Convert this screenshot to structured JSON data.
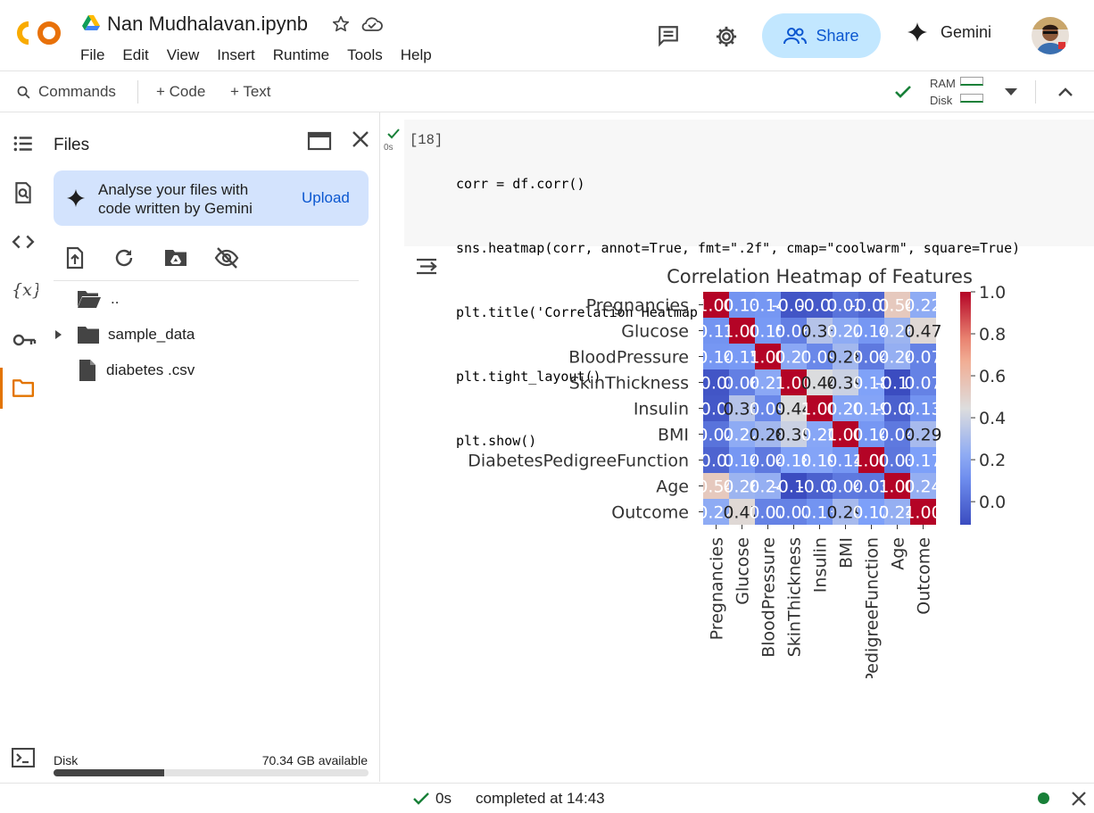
{
  "header": {
    "notebook_title": "Nan Mudhalavan.ipynb",
    "menu": [
      "File",
      "Edit",
      "View",
      "Insert",
      "Runtime",
      "Tools",
      "Help"
    ],
    "share_label": "Share",
    "gemini_label": "Gemini",
    "logo_text": "CO"
  },
  "toolbar": {
    "commands_label": "Commands",
    "code_label": "+ Code",
    "text_label": "+ Text",
    "ram_label": "RAM",
    "disk_label": "Disk"
  },
  "files": {
    "title": "Files",
    "gemini_card_line1": "Analyse your files with",
    "gemini_card_line2": "code written by Gemini",
    "upload_label": "Upload",
    "items": [
      {
        "name": "..",
        "icon": "folder-open-icon"
      },
      {
        "name": "sample_data",
        "icon": "folder-icon"
      },
      {
        "name": "diabetes .csv",
        "icon": "file-icon"
      }
    ],
    "disk_label": "Disk",
    "disk_available": "70.34 GB available",
    "disk_used_fraction": 0.35
  },
  "cell": {
    "exec_count": "[18]",
    "exec_time": "0s",
    "code_lines": [
      "corr = df.corr()",
      "sns.heatmap(corr, annot=True, fmt=\".2f\", cmap=\"coolwarm\", square=True)",
      "plt.title('Correlation Heatmap of Features')",
      "plt.tight_layout()",
      "plt.show()"
    ]
  },
  "chart_data": {
    "type": "heatmap",
    "title": "Correlation Heatmap of Features",
    "labels": [
      "Pregnancies",
      "Glucose",
      "BloodPressure",
      "SkinThickness",
      "Insulin",
      "BMI",
      "DiabetesPedigreeFunction",
      "Age",
      "Outcome"
    ],
    "matrix": [
      [
        1.0,
        0.13,
        0.14,
        -0.08,
        -0.07,
        0.02,
        -0.03,
        0.54,
        0.22
      ],
      [
        0.13,
        1.0,
        0.15,
        0.06,
        0.33,
        0.22,
        0.14,
        0.26,
        0.47
      ],
      [
        0.14,
        0.15,
        1.0,
        0.21,
        0.09,
        0.28,
        0.04,
        0.24,
        0.07
      ],
      [
        -0.08,
        0.06,
        0.21,
        1.0,
        0.44,
        0.39,
        0.18,
        -0.11,
        0.07
      ],
      [
        -0.07,
        0.33,
        0.09,
        0.44,
        1.0,
        0.2,
        0.19,
        -0.04,
        0.13
      ],
      [
        0.02,
        0.22,
        0.28,
        0.39,
        0.2,
        1.0,
        0.14,
        0.04,
        0.29
      ],
      [
        -0.03,
        0.14,
        0.04,
        0.18,
        0.19,
        0.14,
        1.0,
        0.03,
        0.17
      ],
      [
        0.54,
        0.26,
        0.24,
        -0.11,
        -0.04,
        0.04,
        0.03,
        1.0,
        0.24
      ],
      [
        0.22,
        0.47,
        0.07,
        0.07,
        0.13,
        0.29,
        0.17,
        0.24,
        1.0
      ]
    ],
    "colorbar_range": [
      -0.11,
      1.0
    ],
    "colorbar_ticks": [
      "0.0",
      "0.2",
      "0.4",
      "0.6",
      "0.8",
      "1.0"
    ],
    "cmap": "coolwarm",
    "fmt": ".2f"
  },
  "status": {
    "time": "0s",
    "text": "completed at 14:43"
  },
  "colors": {
    "accent": "#0b57d0",
    "share_bg": "#c2e7ff",
    "ok_green": "#188038",
    "files_active": "#e37400"
  }
}
